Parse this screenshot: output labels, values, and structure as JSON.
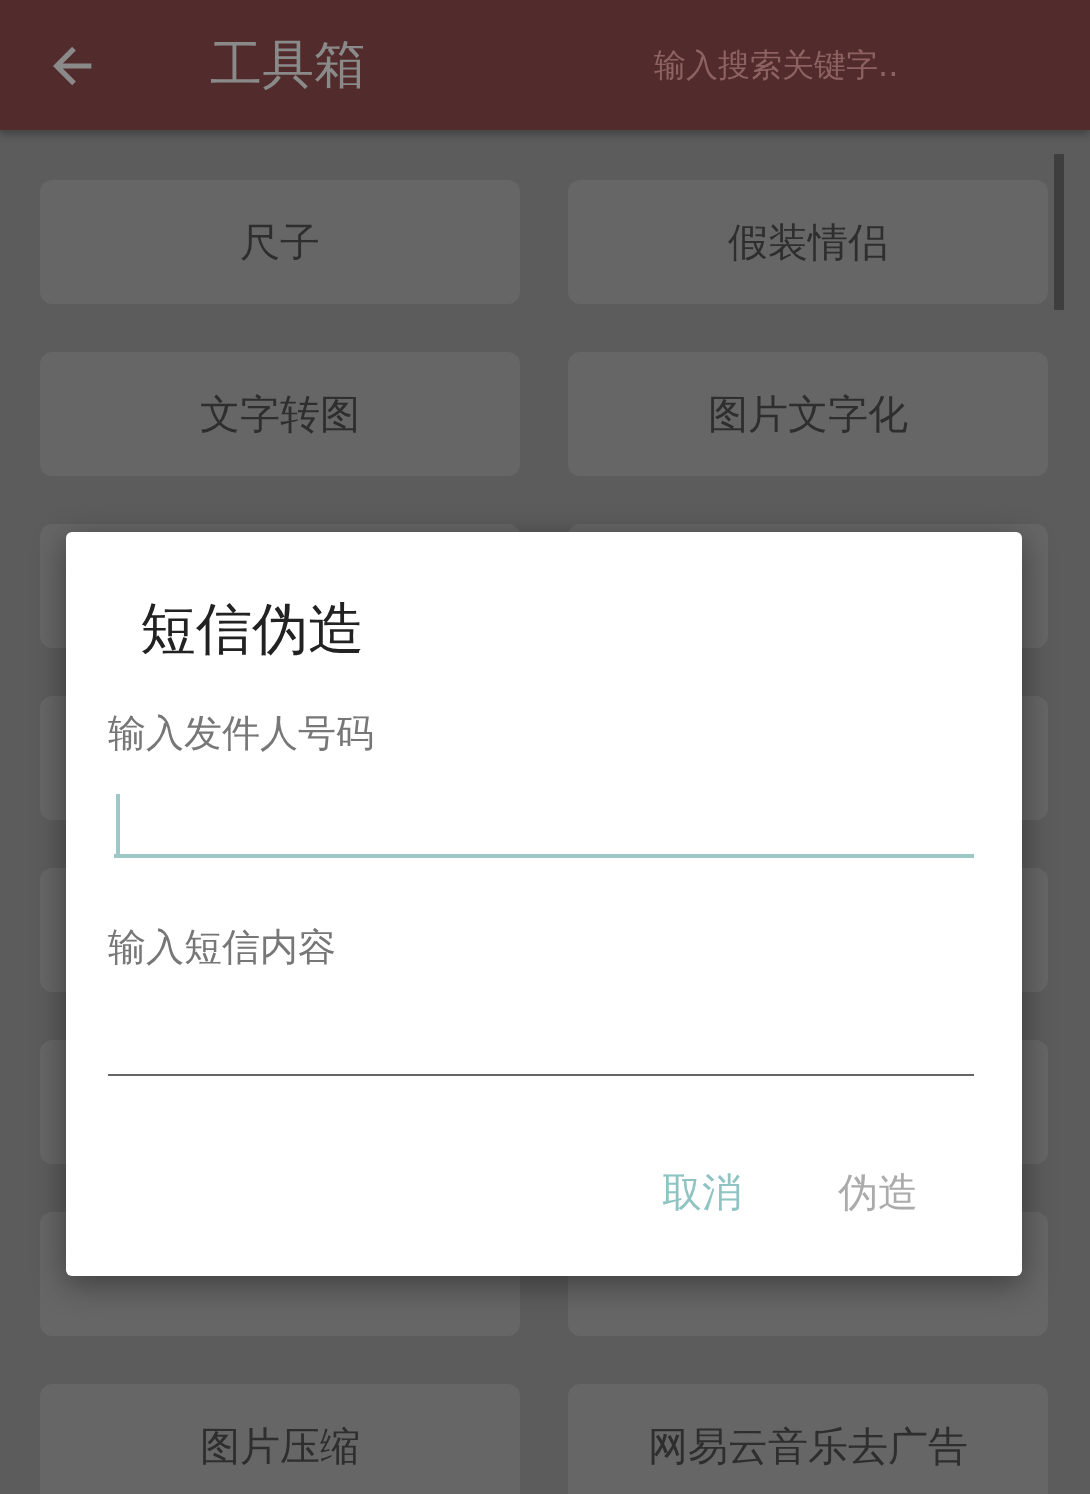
{
  "toolbar": {
    "title": "工具箱",
    "search": {
      "placeholder": "输入搜索关键字.."
    }
  },
  "tools": [
    {
      "label": "尺子"
    },
    {
      "label": "假装情侣"
    },
    {
      "label": "文字转图"
    },
    {
      "label": "图片文字化"
    },
    {
      "label": "图片压缩"
    },
    {
      "label": "网易云音乐去广告"
    }
  ],
  "dialog": {
    "title": "短信伪造",
    "fields": [
      {
        "label": "输入发件人号码",
        "focused": true
      },
      {
        "placeholder": "输入短信内容",
        "focused": false
      }
    ],
    "buttons": [
      {
        "label": "取消",
        "disabled": false
      },
      {
        "label": "伪造",
        "disabled": true
      }
    ]
  }
}
